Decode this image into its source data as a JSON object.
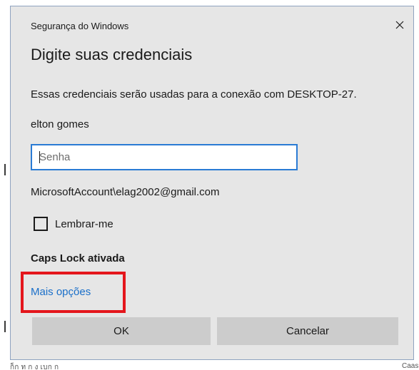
{
  "background": {
    "bottom_text": "ก็ก ท ก ง เบก ก",
    "right_text": "Caas"
  },
  "dialog": {
    "window_title": "Segurança do Windows",
    "close_icon": "close-icon",
    "heading": "Digite suas credenciais",
    "description": "Essas credenciais serão usadas para a conexão com DESKTOP-27.",
    "username": "elton gomes",
    "password": {
      "value": "",
      "placeholder": "Senha"
    },
    "account": "MicrosoftAccount\\elag2002@gmail.com",
    "remember_label": "Lembrar-me",
    "remember_checked": false,
    "caps_lock_warning": "Caps Lock ativada",
    "more_options_label": "Mais opções",
    "ok_label": "OK",
    "cancel_label": "Cancelar"
  },
  "colors": {
    "dialog_bg": "#e6e6e6",
    "link": "#1a6fc9",
    "input_border_focus": "#2a7bd4",
    "button_bg": "#cccccc",
    "highlight": "#e4161c"
  }
}
